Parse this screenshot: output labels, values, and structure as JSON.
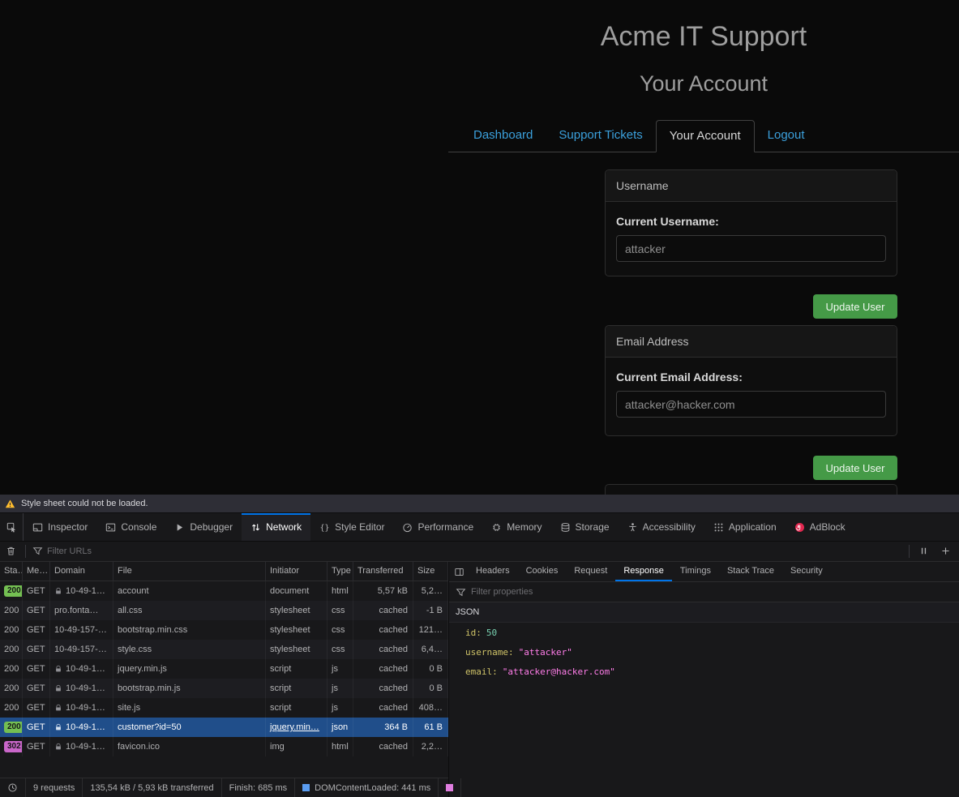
{
  "site": {
    "title": "Acme IT Support",
    "subtitle": "Your Account",
    "nav": {
      "tabs": [
        {
          "label": "Dashboard",
          "active": false
        },
        {
          "label": "Support Tickets",
          "active": false
        },
        {
          "label": "Your Account",
          "active": true
        },
        {
          "label": "Logout",
          "active": false
        }
      ]
    },
    "username_panel": {
      "header": "Username",
      "label": "Current Username:",
      "value": "attacker"
    },
    "email_panel": {
      "header": "Email Address",
      "label": "Current Email Address:",
      "value": "attacker@hacker.com"
    },
    "update_button_label": "Update User"
  },
  "devtools": {
    "notification": {
      "icon": "warning-icon",
      "text": "Style sheet could not be loaded."
    },
    "toolbox_tabs": [
      {
        "label": "Inspector",
        "icon": "inspector-icon",
        "active": false
      },
      {
        "label": "Console",
        "icon": "console-icon",
        "active": false
      },
      {
        "label": "Debugger",
        "icon": "debugger-icon",
        "active": false
      },
      {
        "label": "Network",
        "icon": "network-icon",
        "active": true
      },
      {
        "label": "Style Editor",
        "icon": "style-editor-icon",
        "active": false
      },
      {
        "label": "Performance",
        "icon": "performance-icon",
        "active": false
      },
      {
        "label": "Memory",
        "icon": "memory-icon",
        "active": false
      },
      {
        "label": "Storage",
        "icon": "storage-icon",
        "active": false
      },
      {
        "label": "Accessibility",
        "icon": "accessibility-icon",
        "active": false
      },
      {
        "label": "Application",
        "icon": "application-icon",
        "active": false
      },
      {
        "label": "AdBlock",
        "icon": "adblock-icon",
        "active": false
      }
    ],
    "network_toolbar": {
      "filter_placeholder": "Filter URLs"
    },
    "request_table": {
      "columns": [
        "Sta…",
        "Me…",
        "Domain",
        "File",
        "Initiator",
        "Type",
        "Transferred",
        "Size"
      ],
      "rows": [
        {
          "status": "200",
          "badge": "green",
          "method": "GET",
          "lock": true,
          "domain": "10-49-1…",
          "file": "account",
          "initiator": "document",
          "initiator_link": false,
          "type": "html",
          "transferred": "5,57 kB",
          "size": "5,2…",
          "selected": false
        },
        {
          "status": "200",
          "badge": "none",
          "method": "GET",
          "lock": false,
          "domain": "pro.fonta…",
          "file": "all.css",
          "initiator": "stylesheet",
          "initiator_link": false,
          "type": "css",
          "transferred": "cached",
          "size": "-1 B",
          "selected": false
        },
        {
          "status": "200",
          "badge": "none",
          "method": "GET",
          "lock": false,
          "domain": "10-49-157-…",
          "file": "bootstrap.min.css",
          "initiator": "stylesheet",
          "initiator_link": false,
          "type": "css",
          "transferred": "cached",
          "size": "121…",
          "selected": false
        },
        {
          "status": "200",
          "badge": "none",
          "method": "GET",
          "lock": false,
          "domain": "10-49-157-…",
          "file": "style.css",
          "initiator": "stylesheet",
          "initiator_link": false,
          "type": "css",
          "transferred": "cached",
          "size": "6,4…",
          "selected": false
        },
        {
          "status": "200",
          "badge": "none",
          "method": "GET",
          "lock": true,
          "domain": "10-49-1…",
          "file": "jquery.min.js",
          "initiator": "script",
          "initiator_link": false,
          "type": "js",
          "transferred": "cached",
          "size": "0 B",
          "selected": false
        },
        {
          "status": "200",
          "badge": "none",
          "method": "GET",
          "lock": true,
          "domain": "10-49-1…",
          "file": "bootstrap.min.js",
          "initiator": "script",
          "initiator_link": false,
          "type": "js",
          "transferred": "cached",
          "size": "0 B",
          "selected": false
        },
        {
          "status": "200",
          "badge": "none",
          "method": "GET",
          "lock": true,
          "domain": "10-49-1…",
          "file": "site.js",
          "initiator": "script",
          "initiator_link": false,
          "type": "js",
          "transferred": "cached",
          "size": "408…",
          "selected": false
        },
        {
          "status": "200",
          "badge": "green",
          "method": "GET",
          "lock": true,
          "domain": "10-49-1…",
          "file": "customer?id=50",
          "initiator": "jquery.min…",
          "initiator_link": true,
          "type": "json",
          "transferred": "364 B",
          "size": "61 B",
          "selected": true
        },
        {
          "status": "302",
          "badge": "purple",
          "method": "GET",
          "lock": true,
          "domain": "10-49-1…",
          "file": "favicon.ico",
          "initiator": "img",
          "initiator_link": false,
          "type": "html",
          "transferred": "cached",
          "size": "2,2…",
          "selected": false
        }
      ]
    },
    "details": {
      "tabs": [
        {
          "label": "Headers",
          "active": false
        },
        {
          "label": "Cookies",
          "active": false
        },
        {
          "label": "Request",
          "active": false
        },
        {
          "label": "Response",
          "active": true
        },
        {
          "label": "Timings",
          "active": false
        },
        {
          "label": "Stack Trace",
          "active": false
        },
        {
          "label": "Security",
          "active": false
        }
      ],
      "filter_placeholder": "Filter properties",
      "section_label": "JSON",
      "properties": [
        {
          "key": "id",
          "value": "50",
          "kind": "number"
        },
        {
          "key": "username",
          "value": "\"attacker\"",
          "kind": "string"
        },
        {
          "key": "email",
          "value": "\"attacker@hacker.com\"",
          "kind": "string"
        }
      ]
    },
    "status_bar": {
      "items": [
        {
          "icon": "throttle-icon",
          "label": ""
        },
        {
          "label": "9 requests"
        },
        {
          "label": "135,54 kB / 5,93 kB transferred"
        },
        {
          "label": "Finish: 685 ms"
        },
        {
          "square_color": "#5a9cf0",
          "label": "DOMContentLoaded: 441 ms"
        },
        {
          "square_color": "#df7ddf",
          "label": ""
        }
      ]
    }
  },
  "colors": {
    "accent_blue": "#0074e8",
    "link_blue": "#3ba0dc",
    "button_green": "#459a47",
    "status_green": "#74bf52",
    "status_purple": "#c966c9",
    "selection_blue": "#204e8a",
    "warning_yellow": "#ffbd2e",
    "json_key": "#cfc368",
    "json_number": "#78d0b0",
    "json_string": "#ff7de9"
  }
}
